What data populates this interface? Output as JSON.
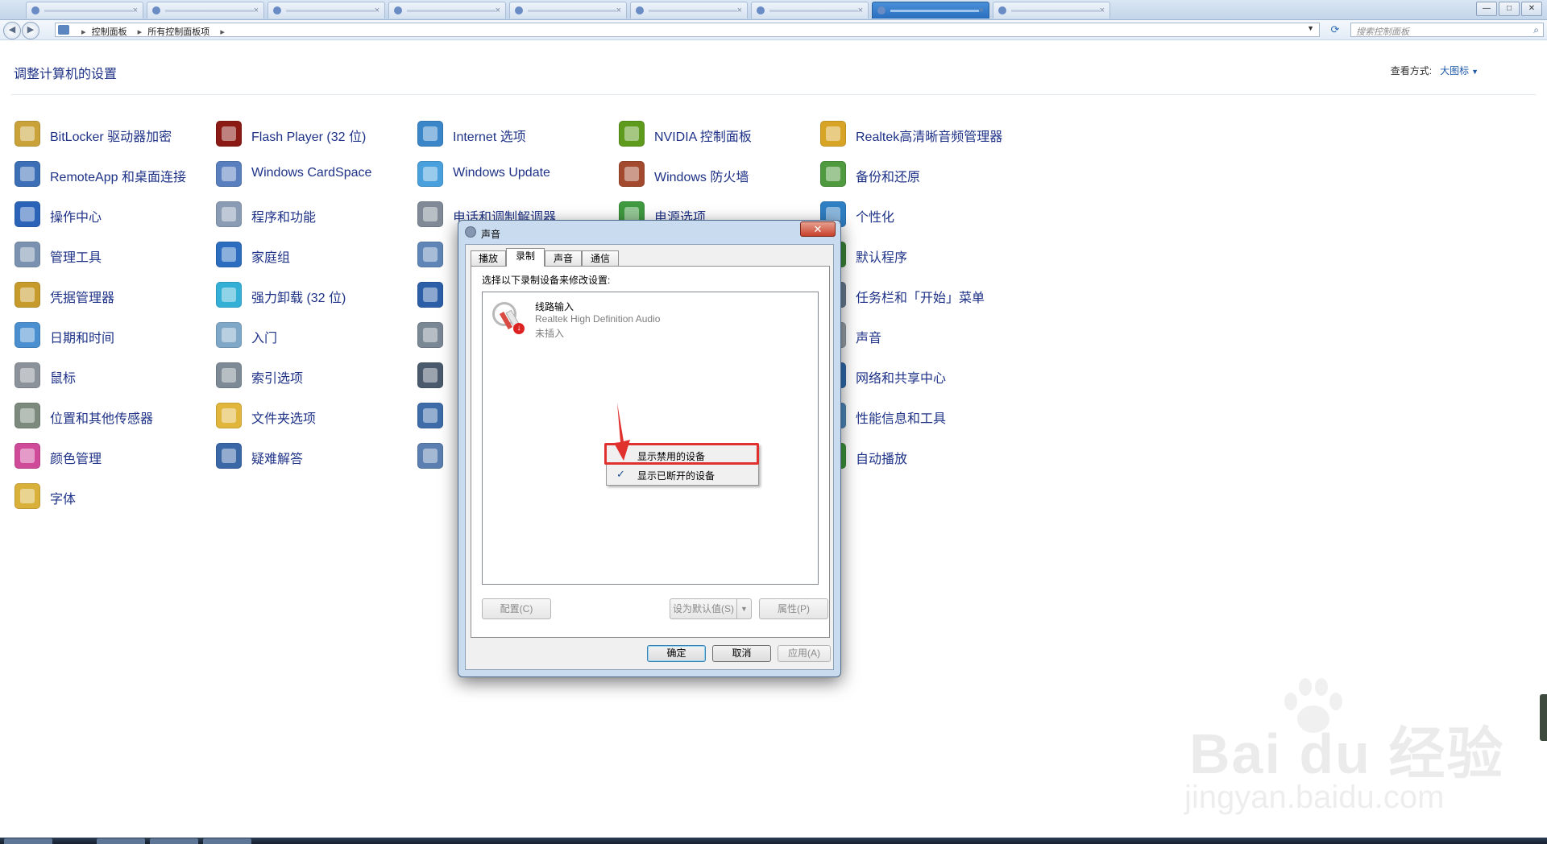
{
  "browser": {
    "tabs": [
      {
        "label": "",
        "active": false
      },
      {
        "label": "",
        "active": false
      },
      {
        "label": "",
        "active": false
      },
      {
        "label": "",
        "active": false
      },
      {
        "label": "",
        "active": false
      },
      {
        "label": "",
        "active": false
      },
      {
        "label": "",
        "active": false
      },
      {
        "label": "",
        "active": true
      },
      {
        "label": "",
        "active": false
      }
    ],
    "window_buttons": {
      "minimize": "—",
      "maximize": "□",
      "close": "✕"
    }
  },
  "addressbar": {
    "breadcrumbs": [
      "控制面板",
      "所有控制面板项"
    ],
    "search_placeholder": "搜索控制面板"
  },
  "header": {
    "title": "调整计算机的设置",
    "view_by_label": "查看方式:",
    "view_by_value": "大图标"
  },
  "items": [
    {
      "label": "BitLocker 驱动器加密",
      "icon": "bitlocker-icon",
      "color": "#c9a23a"
    },
    {
      "label": "Flash Player (32 位)",
      "icon": "flash-player-icon",
      "color": "#8b1a14"
    },
    {
      "label": "Internet 选项",
      "icon": "internet-options-icon",
      "color": "#3a86c8"
    },
    {
      "label": "NVIDIA 控制面板",
      "icon": "nvidia-icon",
      "color": "#5e9a1c"
    },
    {
      "label": "Realtek高清晰音频管理器",
      "icon": "realtek-audio-icon",
      "color": "#d8a426"
    },
    {
      "label": "RemoteApp 和桌面连接",
      "icon": "remoteapp-icon",
      "color": "#3c6fb5"
    },
    {
      "label": "Windows CardSpace",
      "icon": "cardspace-icon",
      "color": "#5a7fbf"
    },
    {
      "label": "Windows Update",
      "icon": "windows-update-icon",
      "color": "#4aa0dc"
    },
    {
      "label": "Windows 防火墙",
      "icon": "firewall-icon",
      "color": "#a34a2e"
    },
    {
      "label": "备份和还原",
      "icon": "backup-icon",
      "color": "#4f9a3e"
    },
    {
      "label": "操作中心",
      "icon": "action-center-icon",
      "color": "#2a63b8"
    },
    {
      "label": "程序和功能",
      "icon": "programs-icon",
      "color": "#8a9bb4"
    },
    {
      "label": "电话和调制解调器",
      "icon": "phone-modem-icon",
      "color": "#7f8a96"
    },
    {
      "label": "电源选项",
      "icon": "power-options-icon",
      "color": "#3f9a40"
    },
    {
      "label": "个性化",
      "icon": "personalization-icon",
      "color": "#2f7fc4"
    },
    {
      "label": "管理工具",
      "icon": "admin-tools-icon",
      "color": "#7a92b0"
    },
    {
      "label": "家庭组",
      "icon": "homegroup-icon",
      "color": "#2d6dbf"
    },
    {
      "label": "",
      "icon": "people-icon",
      "color": "#5f86b6"
    },
    {
      "label": "",
      "icon": "blank-icon",
      "color": "#ffffff"
    },
    {
      "label": "默认程序",
      "icon": "default-programs-icon",
      "color": "#3d8a3a"
    },
    {
      "label": "凭据管理器",
      "icon": "credential-icon",
      "color": "#c69b2c"
    },
    {
      "label": "强力卸载 (32 位)",
      "icon": "uninstaller-icon",
      "color": "#34b0d6"
    },
    {
      "label": "",
      "icon": "sync-center-icon",
      "color": "#2c5fa8"
    },
    {
      "label": "",
      "icon": "blank-icon",
      "color": "#ffffff"
    },
    {
      "label": "任务栏和「开始」菜单",
      "icon": "taskbar-icon",
      "color": "#6b7f96"
    },
    {
      "label": "日期和时间",
      "icon": "date-time-icon",
      "color": "#4a8fd0"
    },
    {
      "label": "入门",
      "icon": "getting-started-icon",
      "color": "#7fa8c8"
    },
    {
      "label": "",
      "icon": "device-manager-icon",
      "color": "#7a8794"
    },
    {
      "label": "",
      "icon": "blank-icon",
      "color": "#ffffff"
    },
    {
      "label": "声音",
      "icon": "sound-icon",
      "color": "#9aa4ad"
    },
    {
      "label": "鼠标",
      "icon": "mouse-icon",
      "color": "#8b929a"
    },
    {
      "label": "索引选项",
      "icon": "indexing-icon",
      "color": "#7d8a95"
    },
    {
      "label": "",
      "icon": "notification-icon",
      "color": "#4a5a6c"
    },
    {
      "label": "",
      "icon": "blank-icon",
      "color": "#ffffff"
    },
    {
      "label": "网络和共享中心",
      "icon": "network-icon",
      "color": "#2f6cb3"
    },
    {
      "label": "位置和其他传感器",
      "icon": "location-icon",
      "color": "#7b8a7c"
    },
    {
      "label": "文件夹选项",
      "icon": "folder-options-icon",
      "color": "#e0b73c"
    },
    {
      "label": "",
      "icon": "system-icon",
      "color": "#3d6ca9"
    },
    {
      "label": "",
      "icon": "blank-icon",
      "color": "#ffffff"
    },
    {
      "label": "性能信息和工具",
      "icon": "performance-icon",
      "color": "#4f8ac0"
    },
    {
      "label": "颜色管理",
      "icon": "color-management-icon",
      "color": "#d04a9a"
    },
    {
      "label": "疑难解答",
      "icon": "troubleshooting-icon",
      "color": "#3a67a6"
    },
    {
      "label": "",
      "icon": "users-icon",
      "color": "#5b7fb0"
    },
    {
      "label": "",
      "icon": "blank-icon",
      "color": "#ffffff"
    },
    {
      "label": "自动播放",
      "icon": "autoplay-icon",
      "color": "#3e9a3e"
    },
    {
      "label": "字体",
      "icon": "fonts-icon",
      "color": "#d9b13a"
    }
  ],
  "dialog": {
    "title": "声音",
    "close_glyph": "✕",
    "tabs": [
      {
        "label": "播放",
        "active": false
      },
      {
        "label": "录制",
        "active": true
      },
      {
        "label": "声音",
        "active": false
      },
      {
        "label": "通信",
        "active": false
      }
    ],
    "instruction": "选择以下录制设备来修改设置:",
    "device": {
      "name": "线路输入",
      "driver": "Realtek High Definition Audio",
      "state": "未插入"
    },
    "configure_btn": "配置(C)",
    "set_default_btn": "设为默认值(S)",
    "properties_btn": "属性(P)",
    "ok_btn": "确定",
    "cancel_btn": "取消",
    "apply_btn": "应用(A)"
  },
  "context_menu": {
    "items": [
      {
        "label": "显示禁用的设备",
        "checked": false
      },
      {
        "label": "显示已断开的设备",
        "checked": true
      }
    ],
    "check_glyph": "✓"
  },
  "watermark": {
    "logo": "Bai du 经验",
    "url": "jingyan.baidu.com"
  },
  "colors": {
    "link_blue": "#1e3287",
    "highlight_red": "#e0312f"
  }
}
